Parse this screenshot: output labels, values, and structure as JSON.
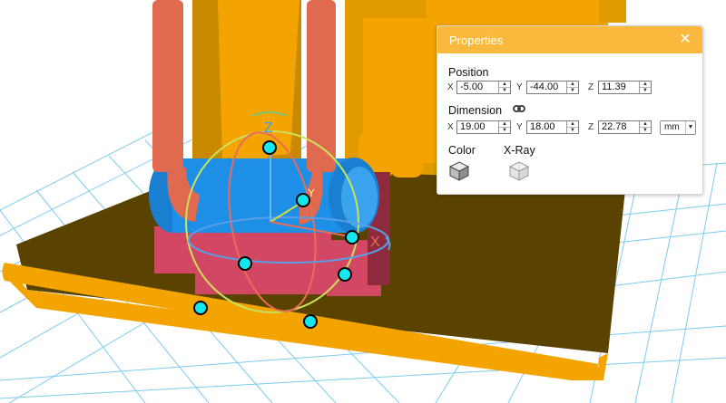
{
  "properties_panel": {
    "title": "Properties",
    "position": {
      "label": "Position",
      "x_label": "X",
      "x_value": "-5.00",
      "y_label": "Y",
      "y_value": "-44.00",
      "z_label": "Z",
      "z_value": "11.39"
    },
    "dimension": {
      "label": "Dimension",
      "x_label": "X",
      "x_value": "19.00",
      "y_label": "Y",
      "y_value": "18.00",
      "z_label": "Z",
      "z_value": "22.78",
      "unit": "mm"
    },
    "color_label": "Color",
    "xray_label": "X-Ray"
  },
  "gizmo": {
    "z_axis_label": "Z",
    "y_axis_label": "Y",
    "x_axis_label": "X"
  },
  "colors": {
    "panel_header": "#f9b93c",
    "model_orange": "#f4a400",
    "cylinder_blue": "#1e8fe6",
    "support_red": "#e06a50",
    "block_red": "#d24763",
    "grid_blue": "#6ec6ee",
    "handle_cyan": "#14e8ee"
  }
}
